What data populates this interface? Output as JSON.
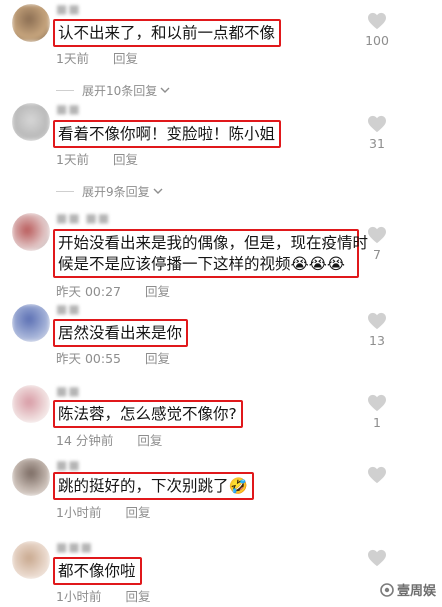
{
  "comments": [
    {
      "text": "认不出来了，和以前一点都不像",
      "time": "1天前",
      "reply": "回复",
      "likes": "100"
    },
    {
      "text": "看着不像你啊！变脸啦！陈小姐",
      "time": "1天前",
      "reply": "回复",
      "likes": "31"
    },
    {
      "text_line1": "开始没看出来是我的偶像，但是，现在疫情时",
      "text_line2": "候是不是应该停播一下这样的视频😭😭😭",
      "time": "昨天 00:27",
      "reply": "回复",
      "likes": "7"
    },
    {
      "text": "居然没看出来是你",
      "time": "昨天 00:55",
      "reply": "回复",
      "likes": "13"
    },
    {
      "text": "陈法蓉，怎么感觉不像你?",
      "time": "14 分钟前",
      "reply": "回复",
      "likes": "1"
    },
    {
      "text": "跳的挺好的，下次别跳了🤣",
      "time": "1小时前",
      "reply": "回复",
      "likes": ""
    },
    {
      "text": "都不像你啦",
      "time": "1小时前",
      "reply": "回复",
      "likes": ""
    }
  ],
  "expand": [
    {
      "label": "展开10条回复"
    },
    {
      "label": "展开9条回复"
    }
  ],
  "watermark": "壹周娱",
  "colors": {
    "highlight_border": "#e0181b",
    "meta_text": "#8e8e8e",
    "heart": "#d0d0d0"
  }
}
